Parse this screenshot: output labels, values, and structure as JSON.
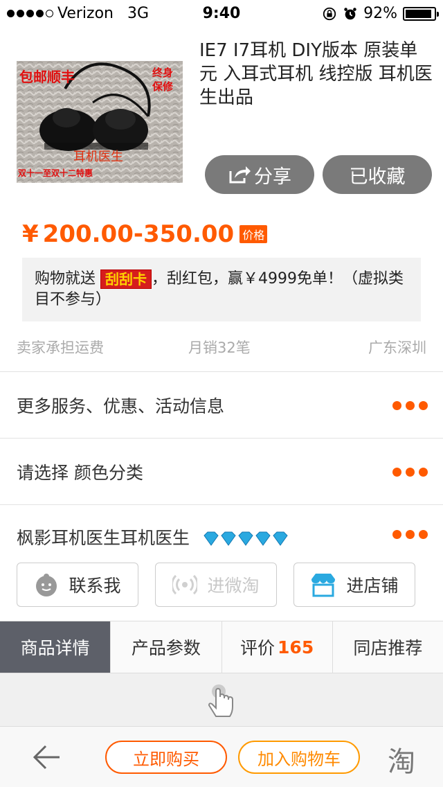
{
  "status_bar": {
    "carrier": "Verizon",
    "network": "3G",
    "time": "9:40",
    "battery": "92%",
    "battery_level": 0.92,
    "icons": [
      "rotation-lock-icon",
      "alarm-icon",
      "battery-icon"
    ]
  },
  "product": {
    "title": "IE7 I7耳机 DIY版本 原装单元 入耳式耳机 线控版 耳机医生出品",
    "image_overlay": {
      "top_left": "包邮顺丰",
      "top_right_1": "终身",
      "top_right_2": "保修",
      "brand": "耳机医生",
      "bottom": "双十一至双十二特惠"
    },
    "price_symbol": "¥",
    "price": "200.00-350.00",
    "price_tag": "价格"
  },
  "actions": {
    "share": "分享",
    "favorited": "已收藏"
  },
  "promo": {
    "prefix": "购物就送",
    "badge": "刮刮卡",
    "text": "，刮红包，赢￥4999免单！（虚拟类目不参与）"
  },
  "info": {
    "shipping": "卖家承担运费",
    "monthly_sales": "月销32笔",
    "location": "广东深圳"
  },
  "rows": {
    "services": "更多服务、优惠、活动信息",
    "select": "请选择 颜色分类",
    "shop_name": "枫影耳机医生耳机医生"
  },
  "shop_buttons": {
    "contact": "联系我",
    "weitao": "进微淘",
    "store": "进店铺"
  },
  "tabs": [
    {
      "label": "商品详情"
    },
    {
      "label": "产品参数"
    },
    {
      "label": "评价",
      "count": "165"
    },
    {
      "label": "同店推荐"
    }
  ],
  "bottom_bar": {
    "buy_now": "立即购买",
    "add_cart": "加入购物车",
    "taobao": "淘"
  },
  "colors": {
    "accent": "#ff5a00",
    "button_gray": "#7a7a7a",
    "active_tab": "#5d6069"
  }
}
